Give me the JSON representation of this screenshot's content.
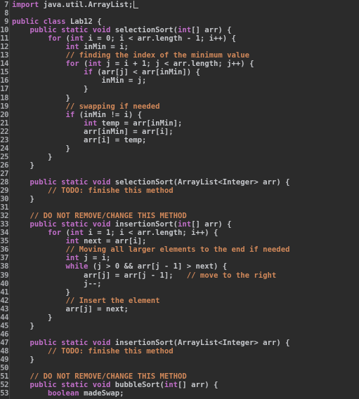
{
  "editor": {
    "language": "java",
    "cursor_line": 7,
    "colors": {
      "background": "#2b2b2b",
      "keyword": "#c16fc9",
      "comment": "#d2895a",
      "text": "#c5c7cb",
      "line_number": "#a9abaf"
    },
    "lines": [
      {
        "n": "7",
        "tokens": [
          [
            "kw",
            "import"
          ],
          [
            "tx",
            " java.util.ArrayList;"
          ]
        ],
        "caret": true
      },
      {
        "n": "8",
        "tokens": []
      },
      {
        "n": "9",
        "tokens": [
          [
            "kw",
            "public class"
          ],
          [
            "tx",
            " Lab12 {"
          ]
        ]
      },
      {
        "n": "10",
        "tokens": [
          [
            "tx",
            "    "
          ],
          [
            "kw",
            "public static void"
          ],
          [
            "tx",
            " selectionSort("
          ],
          [
            "kw",
            "int"
          ],
          [
            "tx",
            "[] arr) {"
          ]
        ]
      },
      {
        "n": "11",
        "tokens": [
          [
            "tx",
            "        "
          ],
          [
            "kw",
            "for"
          ],
          [
            "tx",
            " ("
          ],
          [
            "kw",
            "int"
          ],
          [
            "tx",
            " i = 0; i < arr.length - 1; i++) {"
          ]
        ]
      },
      {
        "n": "12",
        "tokens": [
          [
            "tx",
            "            "
          ],
          [
            "kw",
            "int"
          ],
          [
            "tx",
            " inMin = i;"
          ]
        ]
      },
      {
        "n": "13",
        "tokens": [
          [
            "tx",
            "            "
          ],
          [
            "cm",
            "// finding the index of the minimum value"
          ]
        ]
      },
      {
        "n": "14",
        "tokens": [
          [
            "tx",
            "            "
          ],
          [
            "kw",
            "for"
          ],
          [
            "tx",
            " ("
          ],
          [
            "kw",
            "int"
          ],
          [
            "tx",
            " j = i + 1; j < arr.length; j++) {"
          ]
        ]
      },
      {
        "n": "15",
        "tokens": [
          [
            "tx",
            "                "
          ],
          [
            "kw",
            "if"
          ],
          [
            "tx",
            " (arr[j] < arr[inMin]) {"
          ]
        ]
      },
      {
        "n": "16",
        "tokens": [
          [
            "tx",
            "                    inMin = j;"
          ]
        ]
      },
      {
        "n": "17",
        "tokens": [
          [
            "tx",
            "                }"
          ]
        ]
      },
      {
        "n": "18",
        "tokens": [
          [
            "tx",
            "            }"
          ]
        ]
      },
      {
        "n": "19",
        "tokens": [
          [
            "tx",
            "            "
          ],
          [
            "cm",
            "// swapping if needed"
          ]
        ]
      },
      {
        "n": "20",
        "tokens": [
          [
            "tx",
            "            "
          ],
          [
            "kw",
            "if"
          ],
          [
            "tx",
            " (inMin != i) {"
          ]
        ]
      },
      {
        "n": "21",
        "tokens": [
          [
            "tx",
            "                "
          ],
          [
            "kw",
            "int"
          ],
          [
            "tx",
            " temp = arr[inMin];"
          ]
        ]
      },
      {
        "n": "22",
        "tokens": [
          [
            "tx",
            "                arr[inMin] = arr[i];"
          ]
        ]
      },
      {
        "n": "23",
        "tokens": [
          [
            "tx",
            "                arr[i] = temp;"
          ]
        ]
      },
      {
        "n": "24",
        "tokens": [
          [
            "tx",
            "            }"
          ]
        ]
      },
      {
        "n": "25",
        "tokens": [
          [
            "tx",
            "        }"
          ]
        ]
      },
      {
        "n": "26",
        "tokens": [
          [
            "tx",
            "    }"
          ]
        ]
      },
      {
        "n": "27",
        "tokens": []
      },
      {
        "n": "28",
        "tokens": [
          [
            "tx",
            "    "
          ],
          [
            "kw",
            "public static void"
          ],
          [
            "tx",
            " selectionSort(ArrayList<Integer> arr) {"
          ]
        ]
      },
      {
        "n": "29",
        "tokens": [
          [
            "tx",
            "        "
          ],
          [
            "cm",
            "// TODO: finishe this method"
          ]
        ]
      },
      {
        "n": "30",
        "tokens": [
          [
            "tx",
            "    }"
          ]
        ]
      },
      {
        "n": "31",
        "tokens": []
      },
      {
        "n": "32",
        "tokens": [
          [
            "tx",
            "    "
          ],
          [
            "cm",
            "// DO NOT REMOVE/CHANGE THIS METHOD"
          ]
        ]
      },
      {
        "n": "33",
        "tokens": [
          [
            "tx",
            "    "
          ],
          [
            "kw",
            "public static void"
          ],
          [
            "tx",
            " insertionSort("
          ],
          [
            "kw",
            "int"
          ],
          [
            "tx",
            "[] arr) {"
          ]
        ]
      },
      {
        "n": "34",
        "tokens": [
          [
            "tx",
            "        "
          ],
          [
            "kw",
            "for"
          ],
          [
            "tx",
            " ("
          ],
          [
            "kw",
            "int"
          ],
          [
            "tx",
            " i = 1; i < arr.length; i++) {"
          ]
        ]
      },
      {
        "n": "35",
        "tokens": [
          [
            "tx",
            "            "
          ],
          [
            "kw",
            "int"
          ],
          [
            "tx",
            " next = arr[i];"
          ]
        ]
      },
      {
        "n": "36",
        "tokens": [
          [
            "tx",
            "            "
          ],
          [
            "cm",
            "// Moving all larger elements to the end if needed"
          ]
        ]
      },
      {
        "n": "37",
        "tokens": [
          [
            "tx",
            "            "
          ],
          [
            "kw",
            "int"
          ],
          [
            "tx",
            " j = i;"
          ]
        ]
      },
      {
        "n": "38",
        "tokens": [
          [
            "tx",
            "            "
          ],
          [
            "kw",
            "while"
          ],
          [
            "tx",
            " (j > 0 && arr[j - 1] > next) {"
          ]
        ]
      },
      {
        "n": "39",
        "tokens": [
          [
            "tx",
            "                arr[j] = arr[j - 1];   "
          ],
          [
            "cm",
            "// move to the right"
          ]
        ]
      },
      {
        "n": "40",
        "tokens": [
          [
            "tx",
            "                j--;"
          ]
        ]
      },
      {
        "n": "41",
        "tokens": [
          [
            "tx",
            "            }"
          ]
        ]
      },
      {
        "n": "42",
        "tokens": [
          [
            "tx",
            "            "
          ],
          [
            "cm",
            "// Insert the element"
          ]
        ]
      },
      {
        "n": "43",
        "tokens": [
          [
            "tx",
            "            arr[j] = next;"
          ]
        ]
      },
      {
        "n": "44",
        "tokens": [
          [
            "tx",
            "        }"
          ]
        ]
      },
      {
        "n": "45",
        "tokens": [
          [
            "tx",
            "    }"
          ]
        ]
      },
      {
        "n": "46",
        "tokens": []
      },
      {
        "n": "47",
        "tokens": [
          [
            "tx",
            "    "
          ],
          [
            "kw",
            "public static void"
          ],
          [
            "tx",
            " insertionSort(ArrayList<Integer> arr) {"
          ]
        ]
      },
      {
        "n": "48",
        "tokens": [
          [
            "tx",
            "        "
          ],
          [
            "cm",
            "// TODO: finishe this method"
          ]
        ]
      },
      {
        "n": "49",
        "tokens": [
          [
            "tx",
            "    }"
          ]
        ]
      },
      {
        "n": "50",
        "tokens": []
      },
      {
        "n": "51",
        "tokens": [
          [
            "tx",
            "    "
          ],
          [
            "cm",
            "// DO NOT REMOVE/CHANGE THIS METHOD"
          ]
        ]
      },
      {
        "n": "52",
        "tokens": [
          [
            "tx",
            "    "
          ],
          [
            "kw",
            "public static void"
          ],
          [
            "tx",
            " bubbleSort("
          ],
          [
            "kw",
            "int"
          ],
          [
            "tx",
            "[] arr) {"
          ]
        ]
      },
      {
        "n": "53",
        "tokens": [
          [
            "tx",
            "        "
          ],
          [
            "kw",
            "boolean"
          ],
          [
            "tx",
            " madeSwap;"
          ]
        ]
      }
    ]
  }
}
